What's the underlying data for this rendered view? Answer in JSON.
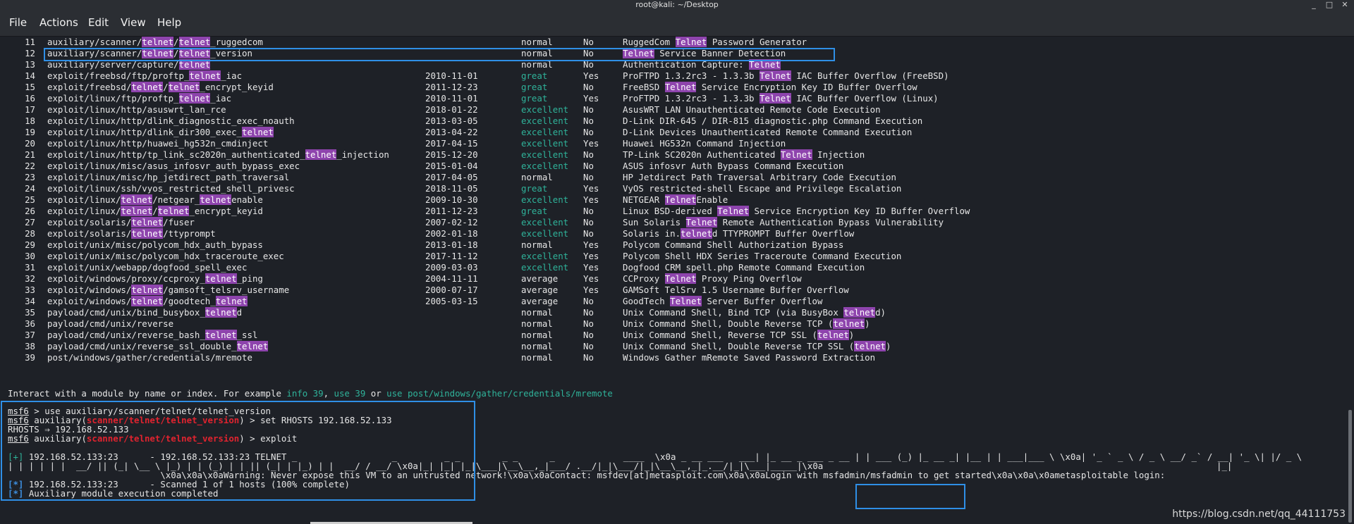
{
  "window": {
    "title": "root@kali: ~/Desktop",
    "controls": [
      "_",
      "□",
      "✕"
    ]
  },
  "menu": [
    "File",
    "Actions",
    "Edit",
    "View",
    "Help"
  ],
  "modules": [
    {
      "n": "11",
      "segs": [
        [
          "auxiliary/scanner/",
          0
        ],
        [
          "telnet",
          1
        ],
        [
          "/",
          0
        ],
        [
          "telnet",
          1
        ],
        [
          "_ruggedcom",
          0
        ]
      ],
      "date": "",
      "rank": "normal",
      "check": "No",
      "desc": [
        [
          "RuggedCom ",
          0
        ],
        [
          "Telnet",
          1
        ],
        [
          " Password Generator",
          0
        ]
      ]
    },
    {
      "n": "12",
      "segs": [
        [
          "auxiliary/scanner/",
          0
        ],
        [
          "telnet",
          1
        ],
        [
          "/",
          0
        ],
        [
          "telnet",
          1
        ],
        [
          "_version",
          0
        ]
      ],
      "date": "",
      "rank": "normal",
      "check": "No",
      "desc": [
        [
          "Telnet",
          1
        ],
        [
          " Service Banner Detection",
          0
        ]
      ]
    },
    {
      "n": "13",
      "segs": [
        [
          "auxiliary/server/capture/",
          0
        ],
        [
          "telnet",
          1
        ]
      ],
      "date": "",
      "rank": "normal",
      "check": "No",
      "desc": [
        [
          "Authentication Capture: ",
          0
        ],
        [
          "Telnet",
          1
        ]
      ]
    },
    {
      "n": "14",
      "segs": [
        [
          "exploit/freebsd/ftp/proftp_",
          0
        ],
        [
          "telnet",
          1
        ],
        [
          "_iac",
          0
        ]
      ],
      "date": "2010-11-01",
      "rank": "great",
      "check": "Yes",
      "desc": [
        [
          "ProFTPD 1.3.2rc3 - 1.3.3b ",
          0
        ],
        [
          "Telnet",
          1
        ],
        [
          " IAC Buffer Overflow (FreeBSD)",
          0
        ]
      ]
    },
    {
      "n": "15",
      "segs": [
        [
          "exploit/freebsd/",
          0
        ],
        [
          "telnet",
          1
        ],
        [
          "/",
          0
        ],
        [
          "telnet",
          1
        ],
        [
          "_encrypt_keyid",
          0
        ]
      ],
      "date": "2011-12-23",
      "rank": "great",
      "check": "No",
      "desc": [
        [
          "FreeBSD ",
          0
        ],
        [
          "Telnet",
          1
        ],
        [
          " Service Encryption Key ID Buffer Overflow",
          0
        ]
      ]
    },
    {
      "n": "16",
      "segs": [
        [
          "exploit/linux/ftp/proftp_",
          0
        ],
        [
          "telnet",
          1
        ],
        [
          "_iac",
          0
        ]
      ],
      "date": "2010-11-01",
      "rank": "great",
      "check": "Yes",
      "desc": [
        [
          "ProFTPD 1.3.2rc3 - 1.3.3b ",
          0
        ],
        [
          "Telnet",
          1
        ],
        [
          " IAC Buffer Overflow (Linux)",
          0
        ]
      ]
    },
    {
      "n": "17",
      "segs": [
        [
          "exploit/linux/http/asuswrt_lan_rce",
          0
        ]
      ],
      "date": "2018-01-22",
      "rank": "excellent",
      "check": "No",
      "desc": [
        [
          "AsusWRT LAN Unauthenticated Remote Code Execution",
          0
        ]
      ]
    },
    {
      "n": "18",
      "segs": [
        [
          "exploit/linux/http/dlink_diagnostic_exec_noauth",
          0
        ]
      ],
      "date": "2013-03-05",
      "rank": "excellent",
      "check": "No",
      "desc": [
        [
          "D-Link DIR-645 / DIR-815 diagnostic.php Command Execution",
          0
        ]
      ]
    },
    {
      "n": "19",
      "segs": [
        [
          "exploit/linux/http/dlink_dir300_exec_",
          0
        ],
        [
          "telnet",
          1
        ]
      ],
      "date": "2013-04-22",
      "rank": "excellent",
      "check": "No",
      "desc": [
        [
          "D-Link Devices Unauthenticated Remote Command Execution",
          0
        ]
      ]
    },
    {
      "n": "20",
      "segs": [
        [
          "exploit/linux/http/huawei_hg532n_cmdinject",
          0
        ]
      ],
      "date": "2017-04-15",
      "rank": "excellent",
      "check": "Yes",
      "desc": [
        [
          "Huawei HG532n Command Injection",
          0
        ]
      ]
    },
    {
      "n": "21",
      "segs": [
        [
          "exploit/linux/http/tp_link_sc2020n_authenticated_",
          0
        ],
        [
          "telnet",
          1
        ],
        [
          "_injection",
          0
        ]
      ],
      "date": "2015-12-20",
      "rank": "excellent",
      "check": "No",
      "desc": [
        [
          "TP-Link SC2020n Authenticated ",
          0
        ],
        [
          "Telnet",
          1
        ],
        [
          " Injection",
          0
        ]
      ]
    },
    {
      "n": "22",
      "segs": [
        [
          "exploit/linux/misc/asus_infosvr_auth_bypass_exec",
          0
        ]
      ],
      "date": "2015-01-04",
      "rank": "excellent",
      "check": "No",
      "desc": [
        [
          "ASUS infosvr Auth Bypass Command Execution",
          0
        ]
      ]
    },
    {
      "n": "23",
      "segs": [
        [
          "exploit/linux/misc/hp_jetdirect_path_traversal",
          0
        ]
      ],
      "date": "2017-04-05",
      "rank": "normal",
      "check": "No",
      "desc": [
        [
          "HP Jetdirect Path Traversal Arbitrary Code Execution",
          0
        ]
      ]
    },
    {
      "n": "24",
      "segs": [
        [
          "exploit/linux/ssh/vyos_restricted_shell_privesc",
          0
        ]
      ],
      "date": "2018-11-05",
      "rank": "great",
      "check": "Yes",
      "desc": [
        [
          "VyOS restricted-shell Escape and Privilege Escalation",
          0
        ]
      ]
    },
    {
      "n": "25",
      "segs": [
        [
          "exploit/linux/",
          0
        ],
        [
          "telnet",
          1
        ],
        [
          "/netgear_",
          0
        ],
        [
          "telnet",
          1
        ],
        [
          "enable",
          0
        ]
      ],
      "date": "2009-10-30",
      "rank": "excellent",
      "check": "Yes",
      "desc": [
        [
          "NETGEAR ",
          0
        ],
        [
          "Telnet",
          1
        ],
        [
          "Enable",
          0
        ]
      ]
    },
    {
      "n": "26",
      "segs": [
        [
          "exploit/linux/",
          0
        ],
        [
          "telnet",
          1
        ],
        [
          "/",
          0
        ],
        [
          "telnet",
          1
        ],
        [
          "_encrypt_keyid",
          0
        ]
      ],
      "date": "2011-12-23",
      "rank": "great",
      "check": "No",
      "desc": [
        [
          "Linux BSD-derived ",
          0
        ],
        [
          "Telnet",
          1
        ],
        [
          " Service Encryption Key ID Buffer Overflow",
          0
        ]
      ]
    },
    {
      "n": "27",
      "segs": [
        [
          "exploit/solaris/",
          0
        ],
        [
          "telnet",
          1
        ],
        [
          "/fuser",
          0
        ]
      ],
      "date": "2007-02-12",
      "rank": "excellent",
      "check": "No",
      "desc": [
        [
          "Sun Solaris ",
          0
        ],
        [
          "Telnet",
          1
        ],
        [
          " Remote Authentication Bypass Vulnerability",
          0
        ]
      ]
    },
    {
      "n": "28",
      "segs": [
        [
          "exploit/solaris/",
          0
        ],
        [
          "telnet",
          1
        ],
        [
          "/ttyprompt",
          0
        ]
      ],
      "date": "2002-01-18",
      "rank": "excellent",
      "check": "No",
      "desc": [
        [
          "Solaris in.",
          0
        ],
        [
          "telnet",
          1
        ],
        [
          "d TTYPROMPT Buffer Overflow",
          0
        ]
      ]
    },
    {
      "n": "29",
      "segs": [
        [
          "exploit/unix/misc/polycom_hdx_auth_bypass",
          0
        ]
      ],
      "date": "2013-01-18",
      "rank": "normal",
      "check": "Yes",
      "desc": [
        [
          "Polycom Command Shell Authorization Bypass",
          0
        ]
      ]
    },
    {
      "n": "30",
      "segs": [
        [
          "exploit/unix/misc/polycom_hdx_traceroute_exec",
          0
        ]
      ],
      "date": "2017-11-12",
      "rank": "excellent",
      "check": "Yes",
      "desc": [
        [
          "Polycom Shell HDX Series Traceroute Command Execution",
          0
        ]
      ]
    },
    {
      "n": "31",
      "segs": [
        [
          "exploit/unix/webapp/dogfood_spell_exec",
          0
        ]
      ],
      "date": "2009-03-03",
      "rank": "excellent",
      "check": "Yes",
      "desc": [
        [
          "Dogfood CRM spell.php Remote Command Execution",
          0
        ]
      ]
    },
    {
      "n": "32",
      "segs": [
        [
          "exploit/windows/proxy/ccproxy_",
          0
        ],
        [
          "telnet",
          1
        ],
        [
          "_ping",
          0
        ]
      ],
      "date": "2004-11-11",
      "rank": "average",
      "check": "Yes",
      "desc": [
        [
          "CCProxy ",
          0
        ],
        [
          "Telnet",
          1
        ],
        [
          " Proxy Ping Overflow",
          0
        ]
      ]
    },
    {
      "n": "33",
      "segs": [
        [
          "exploit/windows/",
          0
        ],
        [
          "telnet",
          1
        ],
        [
          "/gamsoft_telsrv_username",
          0
        ]
      ],
      "date": "2000-07-17",
      "rank": "average",
      "check": "Yes",
      "desc": [
        [
          "GAMSoft TelSrv 1.5 Username Buffer Overflow",
          0
        ]
      ]
    },
    {
      "n": "34",
      "segs": [
        [
          "exploit/windows/",
          0
        ],
        [
          "telnet",
          1
        ],
        [
          "/goodtech_",
          0
        ],
        [
          "telnet",
          1
        ]
      ],
      "date": "2005-03-15",
      "rank": "average",
      "check": "No",
      "desc": [
        [
          "GoodTech ",
          0
        ],
        [
          "Telnet",
          1
        ],
        [
          " Server Buffer Overflow",
          0
        ]
      ]
    },
    {
      "n": "35",
      "segs": [
        [
          "payload/cmd/unix/bind_busybox_",
          0
        ],
        [
          "telnet",
          1
        ],
        [
          "d",
          0
        ]
      ],
      "date": "",
      "rank": "normal",
      "check": "No",
      "desc": [
        [
          "Unix Command Shell, Bind TCP (via BusyBox ",
          0
        ],
        [
          "telnet",
          1
        ],
        [
          "d)",
          0
        ]
      ]
    },
    {
      "n": "36",
      "segs": [
        [
          "payload/cmd/unix/reverse",
          0
        ]
      ],
      "date": "",
      "rank": "normal",
      "check": "No",
      "desc": [
        [
          "Unix Command Shell, Double Reverse TCP (",
          0
        ],
        [
          "telnet",
          1
        ],
        [
          ")",
          0
        ]
      ]
    },
    {
      "n": "37",
      "segs": [
        [
          "payload/cmd/unix/reverse_bash_",
          0
        ],
        [
          "telnet",
          1
        ],
        [
          "_ssl",
          0
        ]
      ],
      "date": "",
      "rank": "normal",
      "check": "No",
      "desc": [
        [
          "Unix Command Shell, Reverse TCP SSL (",
          0
        ],
        [
          "telnet",
          1
        ],
        [
          ")",
          0
        ]
      ]
    },
    {
      "n": "38",
      "segs": [
        [
          "payload/cmd/unix/reverse_ssl_double_",
          0
        ],
        [
          "telnet",
          1
        ]
      ],
      "date": "",
      "rank": "normal",
      "check": "No",
      "desc": [
        [
          "Unix Command Shell, Double Reverse TCP SSL (",
          0
        ],
        [
          "telnet",
          1
        ],
        [
          ")",
          0
        ]
      ]
    },
    {
      "n": "39",
      "segs": [
        [
          "post/windows/gather/credentials/mremote",
          0
        ]
      ],
      "date": "",
      "rank": "normal",
      "check": "No",
      "desc": [
        [
          "Windows Gather mRemote Saved Password Extraction",
          0
        ]
      ]
    }
  ],
  "interact": {
    "prefix": "Interact with a module by name or index. For example ",
    "ex1": "info 39",
    "sep1": ", ",
    "ex2": "use 39",
    "sep2": " or ",
    "ex3": "use post/windows/gather/credentials/mremote"
  },
  "session": {
    "prompt": "msf6",
    "cmd1": " > use auxiliary/scanner/telnet/telnet_version",
    "mod_prefix": " auxiliary(",
    "mod": "scanner/telnet/telnet_version",
    "mod_suffix": ") > ",
    "cmd2": "set RHOSTS 192.168.52.133",
    "rhosts": "RHOSTS ⇒ 192.168.52.133",
    "cmd3": "exploit"
  },
  "output": {
    "plus": "[+]",
    "star": "[*]",
    "l1": " 192.168.52.133:23      - 192.168.52.133:23 TELNET _                  _         _ _        _ _      _             ____  \\x0a _ __ ___   ___| |_ __ _ ___ _ __ | | ___ (_) |_ __ _| |__ | | ___|___ \\ \\x0a| '_ ` _ \\ / _ \\ __/ _` / __| '_ \\| |/ _ \\",
    "l2": "| | | | | |  __/ || (_| \\__ \\ |_) | | (_) | | || (_| | |_) | |  __/ / __/ \\x0a|_| |_| |_|\\___|\\__\\__,_|___/ .__/|_|\\___/|_|\\__\\__,_|_.__/|_|\\___|_____|\\x0a",
    "l2b": "|_|",
    "l3a": "                             \\x0a\\x0a\\x0aWarning: Never expose this VM to an untrusted network!\\x0a\\x0aContact: msfdev[at]metasploit.com\\x0a\\x0aLogin with ",
    "cred": "msfadmin/msfadmin",
    "l3b": " to get started\\x0a\\x0a\\x0ametasploitable login:",
    "l4": " 192.168.52.133:23      - Scanned 1 of 1 hosts (100% complete)",
    "l5": " Auxiliary module execution completed"
  },
  "watermark": "https://blog.csdn.net/qq_44111753",
  "colors": {
    "highlight": "#8e44ad",
    "green": "#2fb39a",
    "red": "#e0232f",
    "annotation": "#2f8fe6"
  }
}
